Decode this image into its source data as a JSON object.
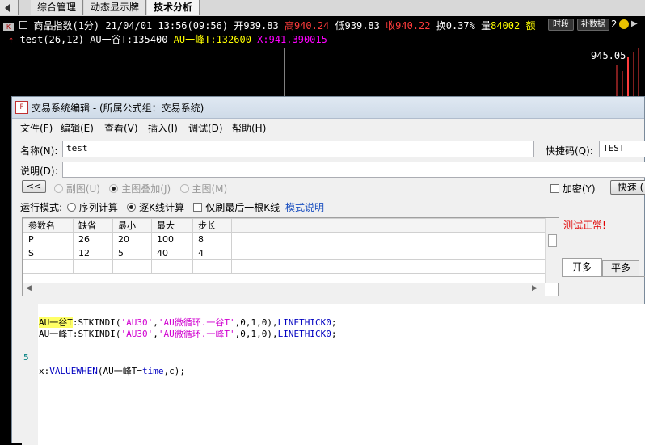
{
  "tabs": {
    "tab1": "综合管理",
    "tab2": "动态显示牌",
    "tab3": "技术分析"
  },
  "chart": {
    "info_line": {
      "symbol": "商品指数(1分)",
      "datetime": "21/04/01 13:56(09:56)",
      "open": "开939.83",
      "high": "高940.24",
      "low": "低939.83",
      "close": "收940.22",
      "change": "换0.37%",
      "volume_label": "量",
      "volume": "84002",
      "amount": "额",
      "period_btn": "时段",
      "supplement_btn": "补数据",
      "num": "2"
    },
    "indicator_line": {
      "name": "test(26,12)",
      "au_valley": "AU一谷T:135400",
      "au_peak": "AU一峰T:132600",
      "x": "X:941.390015"
    },
    "price_label": "945.05",
    "colors": {
      "high": "#ff3c3c",
      "indicator_yellow": "#ffff00",
      "x_magenta": "#ff00ff"
    }
  },
  "dialog": {
    "title": "交易系统编辑 - (所属公式组：交易系统)",
    "menu": [
      "文件(F)",
      "编辑(E)",
      "查看(V)",
      "插入(I)",
      "调试(D)",
      "帮助(H)"
    ],
    "name_label": "名称(N):",
    "name_value": "test",
    "shortcut_label": "快捷码(Q):",
    "shortcut_value": "TEST",
    "desc_label": "说明(D):",
    "desc_value": "",
    "back_btn": "<<",
    "sub_chart": "副图(U)",
    "main_overlay": "主图叠加(J)",
    "main_chart": "主图(M)",
    "encrypt": "加密(Y)",
    "fast_btn": "快速 (",
    "run_mode_label": "运行模式:",
    "seq_calc": "序列计算",
    "tick_calc": "逐K线计算",
    "last_only": "仅刷最后一根K线",
    "mode_help": "模式说明",
    "test_ok": "测试正常!",
    "table": {
      "headers": [
        "参数名",
        "缺省",
        "最小",
        "最大",
        "步长"
      ],
      "rows": [
        [
          "P",
          "26",
          "20",
          "100",
          "8"
        ],
        [
          "S",
          "12",
          "5",
          "40",
          "4"
        ]
      ]
    },
    "side_tabs": [
      "开多",
      "平多"
    ],
    "editor": {
      "line_number": "5",
      "line1_prefix": "AU一谷T",
      "line1_rest_a": ":STKINDI(",
      "line1_str1": "'AU30'",
      "line1_comma": ",",
      "line1_str2": "'AU微循环.一谷T'",
      "line1_args": ",0,1,0),",
      "line1_kw": "LINETHICK0",
      "line1_end": ";",
      "line2_prefix": "AU一峰T",
      "line2_rest_a": ":STKINDI(",
      "line2_str1": "'AU30'",
      "line2_comma": ",",
      "line2_str2": "'AU微循环.一峰T'",
      "line2_args": ",0,1,0),",
      "line2_kw": "LINETHICK0",
      "line2_end": ";",
      "line3_a": "x:",
      "line3_fn": "VALUEWHEN",
      "line3_b": "(AU一峰T=",
      "line3_time": "time",
      "line3_c": ",c);"
    }
  }
}
